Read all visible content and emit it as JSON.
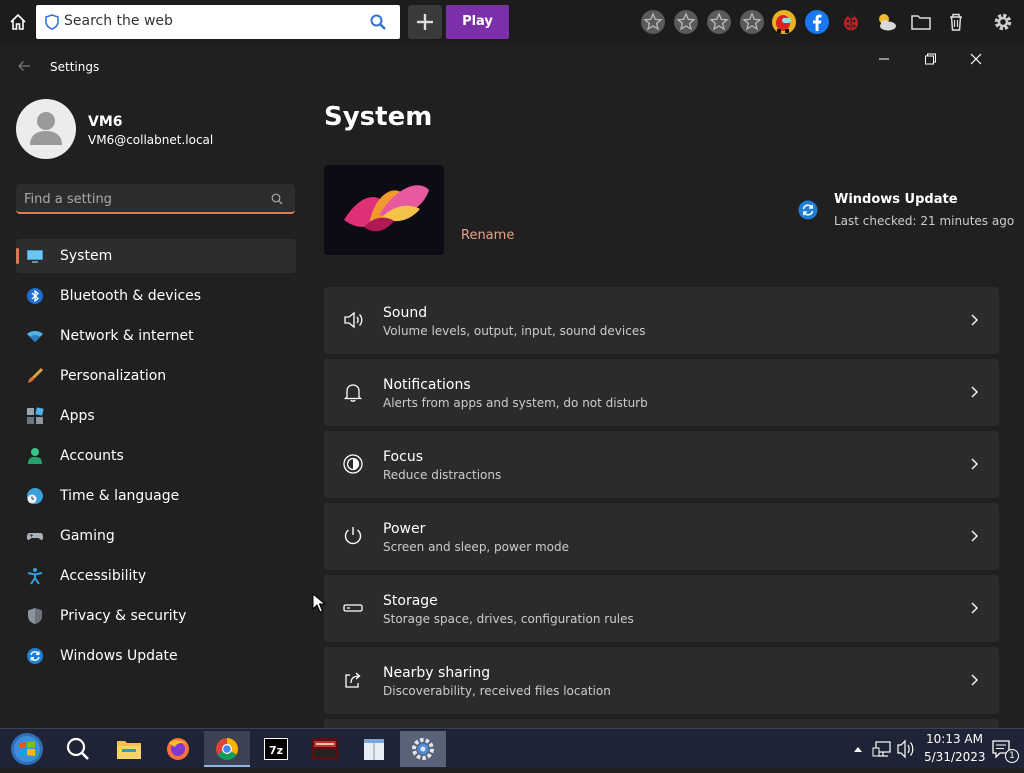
{
  "browser_toolbar": {
    "search_placeholder": "Search the web",
    "play_label": "Play"
  },
  "window": {
    "title": "Settings"
  },
  "profile": {
    "name": "VM6",
    "email": "VM6@collabnet.local"
  },
  "search": {
    "placeholder": "Find a setting"
  },
  "sidebar": {
    "items": [
      {
        "label": "System",
        "icon": "monitor-icon",
        "selected": true
      },
      {
        "label": "Bluetooth & devices",
        "icon": "bluetooth-icon"
      },
      {
        "label": "Network & internet",
        "icon": "wifi-icon"
      },
      {
        "label": "Personalization",
        "icon": "brush-icon"
      },
      {
        "label": "Apps",
        "icon": "apps-icon"
      },
      {
        "label": "Accounts",
        "icon": "person-icon"
      },
      {
        "label": "Time & language",
        "icon": "clock-globe-icon"
      },
      {
        "label": "Gaming",
        "icon": "gamepad-icon"
      },
      {
        "label": "Accessibility",
        "icon": "accessibility-icon"
      },
      {
        "label": "Privacy & security",
        "icon": "shield-icon"
      },
      {
        "label": "Windows Update",
        "icon": "update-icon"
      }
    ]
  },
  "main": {
    "title": "System",
    "rename_label": "Rename",
    "windows_update": {
      "title": "Windows Update",
      "subtitle": "Last checked: 21 minutes ago"
    },
    "cards": [
      {
        "title": "Sound",
        "subtitle": "Volume levels, output, input, sound devices",
        "icon": "speaker-icon"
      },
      {
        "title": "Notifications",
        "subtitle": "Alerts from apps and system, do not disturb",
        "icon": "bell-icon"
      },
      {
        "title": "Focus",
        "subtitle": "Reduce distractions",
        "icon": "focus-icon"
      },
      {
        "title": "Power",
        "subtitle": "Screen and sleep, power mode",
        "icon": "power-icon"
      },
      {
        "title": "Storage",
        "subtitle": "Storage space, drives, configuration rules",
        "icon": "drive-icon"
      },
      {
        "title": "Nearby sharing",
        "subtitle": "Discoverability, received files location",
        "icon": "share-icon"
      }
    ]
  },
  "taskbar": {
    "time": "10:13 AM",
    "date": "5/31/2023",
    "notification_count": "1",
    "apps": [
      "start",
      "search",
      "file-explorer",
      "firefox",
      "chrome",
      "7zip",
      "winrar",
      "notepad",
      "settings"
    ]
  },
  "colors": {
    "accent": "#e07b55",
    "background": "#202020",
    "card": "#2b2b2b",
    "play_button": "#7b2fa8"
  }
}
